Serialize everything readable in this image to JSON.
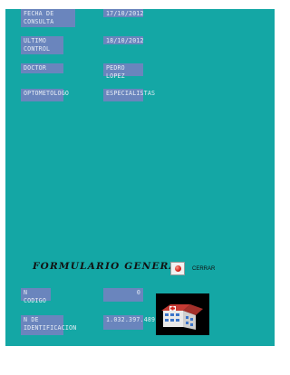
{
  "fields": {
    "fecha_consulta": {
      "label": "FECHA DE CONSULTA",
      "value": "17/10/2012"
    },
    "ultimo_control": {
      "label": "ULTIMO CONTROL",
      "value": "18/10/2012"
    },
    "doctor": {
      "label": "DOCTOR",
      "value": "PEDRO LOPEZ"
    },
    "optometologo": {
      "label": "OPTOMETOLOGO",
      "value": "ESPECIALISTAS"
    },
    "codigo": {
      "label": "N CODIGO",
      "value": "0"
    },
    "identificacion": {
      "label": "N DE IDENTIFICACION",
      "value": "1.032.397.489"
    }
  },
  "form_title": "FORMULARIO GENERA",
  "close_button": {
    "label": "CERRAR"
  },
  "colors": {
    "background": "#14a7a5",
    "field": "#6a85bd",
    "close_icon": "#d2231b"
  },
  "icons": {
    "close": "red-circle-icon",
    "logo": "hospital-building-logo"
  }
}
